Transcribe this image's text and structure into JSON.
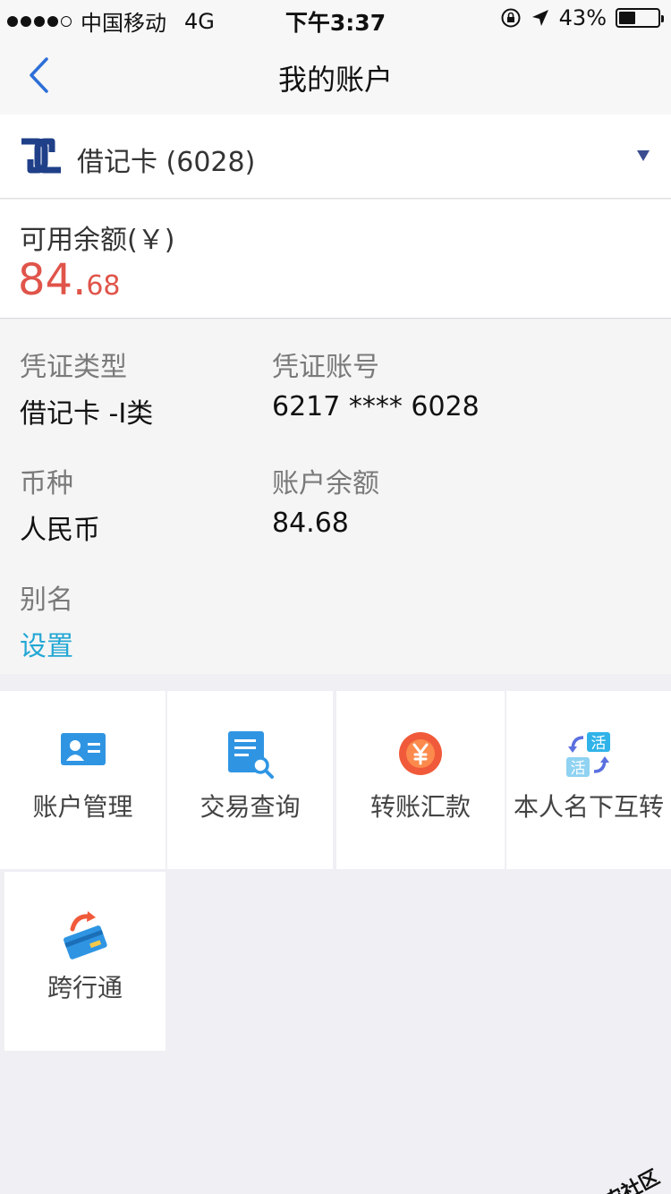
{
  "status_bar": {
    "carrier": "中国移动",
    "network": "4G",
    "time": "下午3:37",
    "battery": "43%",
    "battery_level": 0.43
  },
  "nav": {
    "title": "我的账户",
    "back_icon": "chevron-left-icon"
  },
  "card_selector": {
    "label": "借记卡 (6028)",
    "logo_icon": "bank-logo-icon",
    "dropdown_icon": "triangle-down-icon"
  },
  "balance": {
    "label": "可用余额(￥)",
    "integer": "84.",
    "decimal": "68",
    "color": "#e0544a"
  },
  "details": {
    "voucher_type_label": "凭证类型",
    "voucher_type_value": "借记卡 -I类",
    "voucher_no_label": "凭证账号",
    "voucher_no_value": "6217 **** 6028",
    "currency_label": "币种",
    "currency_value": "人民币",
    "account_balance_label": "账户余额",
    "account_balance_value": "84.68",
    "alias_label": "别名",
    "alias_action": "设置",
    "link_color": "#23a7d4"
  },
  "menu": [
    {
      "label": "账户管理",
      "icon": "id-card-icon"
    },
    {
      "label": "交易查询",
      "icon": "document-search-icon"
    },
    {
      "label": "转账汇款",
      "icon": "yuan-coin-icon"
    },
    {
      "label": "本人名下互转",
      "icon": "swap-huo-icon"
    },
    {
      "label": "跨行通",
      "icon": "card-transfer-icon"
    }
  ],
  "watermark": {
    "text": "卡农社区"
  }
}
